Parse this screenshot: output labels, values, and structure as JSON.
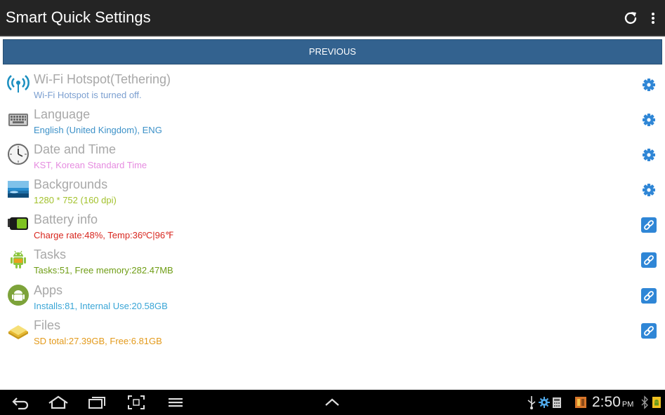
{
  "app": {
    "title": "Smart Quick Settings",
    "refresh_icon": "refresh-icon",
    "overflow_icon": "more-vert-icon"
  },
  "previous_button": {
    "label": "PREVIOUS",
    "color": "#33628f"
  },
  "items": [
    {
      "title": "Wi-Fi Hotspot(Tethering)",
      "subtitle": "Wi-Fi Hotspot is turned off.",
      "subtitle_color": "#7b9fd0",
      "icon": "wifi-hotspot-icon",
      "action": "gear-icon"
    },
    {
      "title": "Language",
      "subtitle": "English (United Kingdom), ENG",
      "subtitle_color": "#3c91c8",
      "icon": "keyboard-icon",
      "action": "gear-icon"
    },
    {
      "title": "Date and Time",
      "subtitle": "KST, Korean Standard Time",
      "subtitle_color": "#e68ce0",
      "icon": "clock-icon",
      "action": "gear-icon"
    },
    {
      "title": "Backgrounds",
      "subtitle": "1280 * 752  (160 dpi)",
      "subtitle_color": "#a3c22d",
      "icon": "wallpaper-icon",
      "action": "gear-icon"
    },
    {
      "title": "Battery info",
      "subtitle": "Charge rate:48%, Temp:36ºC|96℉",
      "subtitle_color": "#d8261e",
      "icon": "battery-icon",
      "action": "link-icon"
    },
    {
      "title": "Tasks",
      "subtitle": "Tasks:51, Free memory:282.47MB",
      "subtitle_color": "#6f9d15",
      "icon": "android-robot-icon",
      "action": "link-icon"
    },
    {
      "title": "Apps",
      "subtitle": "Installs:81, Internal Use:20.58GB",
      "subtitle_color": "#39a5d6",
      "icon": "android-apps-icon",
      "action": "link-icon"
    },
    {
      "title": "Files",
      "subtitle": "SD total:27.39GB, Free:6.81GB",
      "subtitle_color": "#e39a1b",
      "icon": "folder-icon",
      "action": "link-icon"
    }
  ],
  "accent_color": "#2f86d6",
  "navbar": {
    "buttons": [
      "back-icon",
      "home-icon",
      "recent-apps-icon",
      "screenshot-icon",
      "menu-icon",
      "chevron-up-icon"
    ],
    "status_icons": [
      "usb-icon",
      "gear-notification-icon",
      "calculator-icon",
      "app-notification-icon",
      "bluetooth-icon",
      "android-notification-icon"
    ],
    "time": "2:50",
    "ampm": "PM"
  }
}
